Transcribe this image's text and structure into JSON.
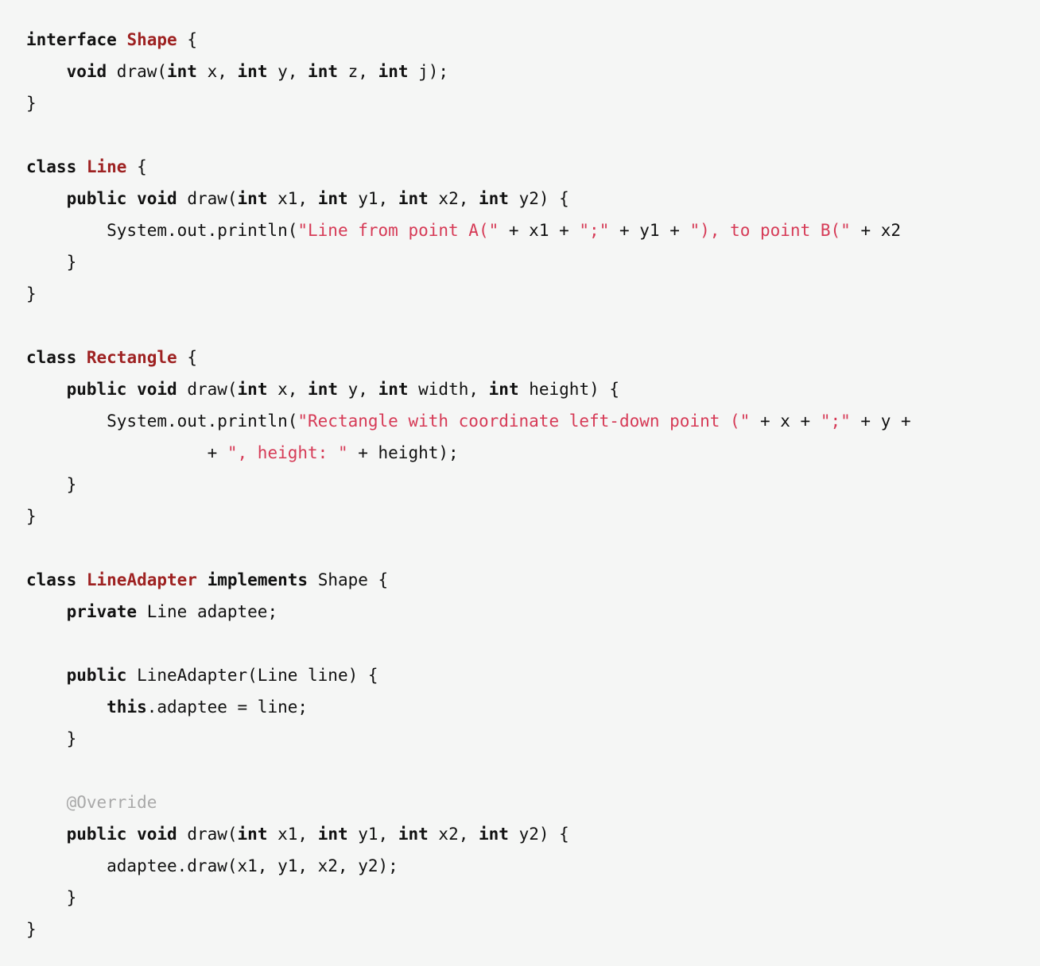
{
  "editor": {
    "language": "Java",
    "background_color": "#f5f6f5",
    "foreground_color": "#111111",
    "keyword_color": "#111111",
    "type_color": "#9e2222",
    "string_color": "#d63a56",
    "annotation_color": "#a9a9a9",
    "clipped_right_edge": true
  },
  "lines": [
    {
      "n": 1,
      "text": "interface Shape {",
      "tokens": [
        {
          "t": "interface",
          "c": "keyword"
        },
        {
          "t": " ",
          "c": "plain"
        },
        {
          "t": "Shape",
          "c": "type"
        },
        {
          "t": " {",
          "c": "plain"
        }
      ]
    },
    {
      "n": 2,
      "text": "    void draw(int x, int y, int z, int j);",
      "tokens": [
        {
          "t": "    ",
          "c": "plain"
        },
        {
          "t": "void",
          "c": "keyword"
        },
        {
          "t": " draw(",
          "c": "plain"
        },
        {
          "t": "int",
          "c": "keyword"
        },
        {
          "t": " x, ",
          "c": "plain"
        },
        {
          "t": "int",
          "c": "keyword"
        },
        {
          "t": " y, ",
          "c": "plain"
        },
        {
          "t": "int",
          "c": "keyword"
        },
        {
          "t": " z, ",
          "c": "plain"
        },
        {
          "t": "int",
          "c": "keyword"
        },
        {
          "t": " j);",
          "c": "plain"
        }
      ]
    },
    {
      "n": 3,
      "text": "}",
      "tokens": [
        {
          "t": "}",
          "c": "plain"
        }
      ]
    },
    {
      "n": 4,
      "text": "",
      "tokens": []
    },
    {
      "n": 5,
      "text": "class Line {",
      "tokens": [
        {
          "t": "class",
          "c": "keyword"
        },
        {
          "t": " ",
          "c": "plain"
        },
        {
          "t": "Line",
          "c": "type"
        },
        {
          "t": " {",
          "c": "plain"
        }
      ]
    },
    {
      "n": 6,
      "text": "    public void draw(int x1, int y1, int x2, int y2) {",
      "tokens": [
        {
          "t": "    ",
          "c": "plain"
        },
        {
          "t": "public",
          "c": "keyword"
        },
        {
          "t": " ",
          "c": "plain"
        },
        {
          "t": "void",
          "c": "keyword"
        },
        {
          "t": " draw(",
          "c": "plain"
        },
        {
          "t": "int",
          "c": "keyword"
        },
        {
          "t": " x1, ",
          "c": "plain"
        },
        {
          "t": "int",
          "c": "keyword"
        },
        {
          "t": " y1, ",
          "c": "plain"
        },
        {
          "t": "int",
          "c": "keyword"
        },
        {
          "t": " x2, ",
          "c": "plain"
        },
        {
          "t": "int",
          "c": "keyword"
        },
        {
          "t": " y2) {",
          "c": "plain"
        }
      ]
    },
    {
      "n": 7,
      "text": "        System.out.println(\"Line from point A(\" + x1 + \";\" + y1 + \"), to point B(\" + x2",
      "tokens": [
        {
          "t": "        System.out.println(",
          "c": "plain"
        },
        {
          "t": "\"Line from point A(\"",
          "c": "string"
        },
        {
          "t": " + x1 + ",
          "c": "plain"
        },
        {
          "t": "\";\"",
          "c": "string"
        },
        {
          "t": " + y1 + ",
          "c": "plain"
        },
        {
          "t": "\"), to point B(\"",
          "c": "string"
        },
        {
          "t": " + x2",
          "c": "plain"
        }
      ]
    },
    {
      "n": 8,
      "text": "    }",
      "tokens": [
        {
          "t": "    }",
          "c": "plain"
        }
      ]
    },
    {
      "n": 9,
      "text": "}",
      "tokens": [
        {
          "t": "}",
          "c": "plain"
        }
      ]
    },
    {
      "n": 10,
      "text": "",
      "tokens": []
    },
    {
      "n": 11,
      "text": "class Rectangle {",
      "tokens": [
        {
          "t": "class",
          "c": "keyword"
        },
        {
          "t": " ",
          "c": "plain"
        },
        {
          "t": "Rectangle",
          "c": "type"
        },
        {
          "t": " {",
          "c": "plain"
        }
      ]
    },
    {
      "n": 12,
      "text": "    public void draw(int x, int y, int width, int height) {",
      "tokens": [
        {
          "t": "    ",
          "c": "plain"
        },
        {
          "t": "public",
          "c": "keyword"
        },
        {
          "t": " ",
          "c": "plain"
        },
        {
          "t": "void",
          "c": "keyword"
        },
        {
          "t": " draw(",
          "c": "plain"
        },
        {
          "t": "int",
          "c": "keyword"
        },
        {
          "t": " x, ",
          "c": "plain"
        },
        {
          "t": "int",
          "c": "keyword"
        },
        {
          "t": " y, ",
          "c": "plain"
        },
        {
          "t": "int",
          "c": "keyword"
        },
        {
          "t": " width, ",
          "c": "plain"
        },
        {
          "t": "int",
          "c": "keyword"
        },
        {
          "t": " height) {",
          "c": "plain"
        }
      ]
    },
    {
      "n": 13,
      "text": "        System.out.println(\"Rectangle with coordinate left-down point (\" + x + \";\" + y +",
      "tokens": [
        {
          "t": "        System.out.println(",
          "c": "plain"
        },
        {
          "t": "\"Rectangle with coordinate left-down point (\"",
          "c": "string"
        },
        {
          "t": " + x + ",
          "c": "plain"
        },
        {
          "t": "\";\"",
          "c": "string"
        },
        {
          "t": " + y +",
          "c": "plain"
        }
      ]
    },
    {
      "n": 14,
      "text": "                  + \", height: \" + height);",
      "tokens": [
        {
          "t": "                  + ",
          "c": "plain"
        },
        {
          "t": "\", height: \"",
          "c": "string"
        },
        {
          "t": " + height);",
          "c": "plain"
        }
      ]
    },
    {
      "n": 15,
      "text": "    }",
      "tokens": [
        {
          "t": "    }",
          "c": "plain"
        }
      ]
    },
    {
      "n": 16,
      "text": "}",
      "tokens": [
        {
          "t": "}",
          "c": "plain"
        }
      ]
    },
    {
      "n": 17,
      "text": "",
      "tokens": []
    },
    {
      "n": 18,
      "text": "class LineAdapter implements Shape {",
      "tokens": [
        {
          "t": "class",
          "c": "keyword"
        },
        {
          "t": " ",
          "c": "plain"
        },
        {
          "t": "LineAdapter",
          "c": "type"
        },
        {
          "t": " ",
          "c": "plain"
        },
        {
          "t": "implements",
          "c": "keyword"
        },
        {
          "t": " Shape {",
          "c": "plain"
        }
      ]
    },
    {
      "n": 19,
      "text": "    private Line adaptee;",
      "tokens": [
        {
          "t": "    ",
          "c": "plain"
        },
        {
          "t": "private",
          "c": "keyword"
        },
        {
          "t": " Line adaptee;",
          "c": "plain"
        }
      ]
    },
    {
      "n": 20,
      "text": "",
      "tokens": []
    },
    {
      "n": 21,
      "text": "    public LineAdapter(Line line) {",
      "tokens": [
        {
          "t": "    ",
          "c": "plain"
        },
        {
          "t": "public",
          "c": "keyword"
        },
        {
          "t": " LineAdapter(Line line) {",
          "c": "plain"
        }
      ]
    },
    {
      "n": 22,
      "text": "        this.adaptee = line;",
      "tokens": [
        {
          "t": "        ",
          "c": "plain"
        },
        {
          "t": "this",
          "c": "keyword"
        },
        {
          "t": ".adaptee = line;",
          "c": "plain"
        }
      ]
    },
    {
      "n": 23,
      "text": "    }",
      "tokens": [
        {
          "t": "    }",
          "c": "plain"
        }
      ]
    },
    {
      "n": 24,
      "text": "",
      "tokens": []
    },
    {
      "n": 25,
      "text": "    @Override",
      "tokens": [
        {
          "t": "    ",
          "c": "plain"
        },
        {
          "t": "@Override",
          "c": "annotation"
        }
      ]
    },
    {
      "n": 26,
      "text": "    public void draw(int x1, int y1, int x2, int y2) {",
      "tokens": [
        {
          "t": "    ",
          "c": "plain"
        },
        {
          "t": "public",
          "c": "keyword"
        },
        {
          "t": " ",
          "c": "plain"
        },
        {
          "t": "void",
          "c": "keyword"
        },
        {
          "t": " draw(",
          "c": "plain"
        },
        {
          "t": "int",
          "c": "keyword"
        },
        {
          "t": " x1, ",
          "c": "plain"
        },
        {
          "t": "int",
          "c": "keyword"
        },
        {
          "t": " y1, ",
          "c": "plain"
        },
        {
          "t": "int",
          "c": "keyword"
        },
        {
          "t": " x2, ",
          "c": "plain"
        },
        {
          "t": "int",
          "c": "keyword"
        },
        {
          "t": " y2) {",
          "c": "plain"
        }
      ]
    },
    {
      "n": 27,
      "text": "        adaptee.draw(x1, y1, x2, y2);",
      "tokens": [
        {
          "t": "        adaptee.draw(x1, y1, x2, y2);",
          "c": "plain"
        }
      ]
    },
    {
      "n": 28,
      "text": "    }",
      "tokens": [
        {
          "t": "    }",
          "c": "plain"
        }
      ]
    },
    {
      "n": 29,
      "text": "}",
      "tokens": [
        {
          "t": "}",
          "c": "plain"
        }
      ]
    }
  ]
}
